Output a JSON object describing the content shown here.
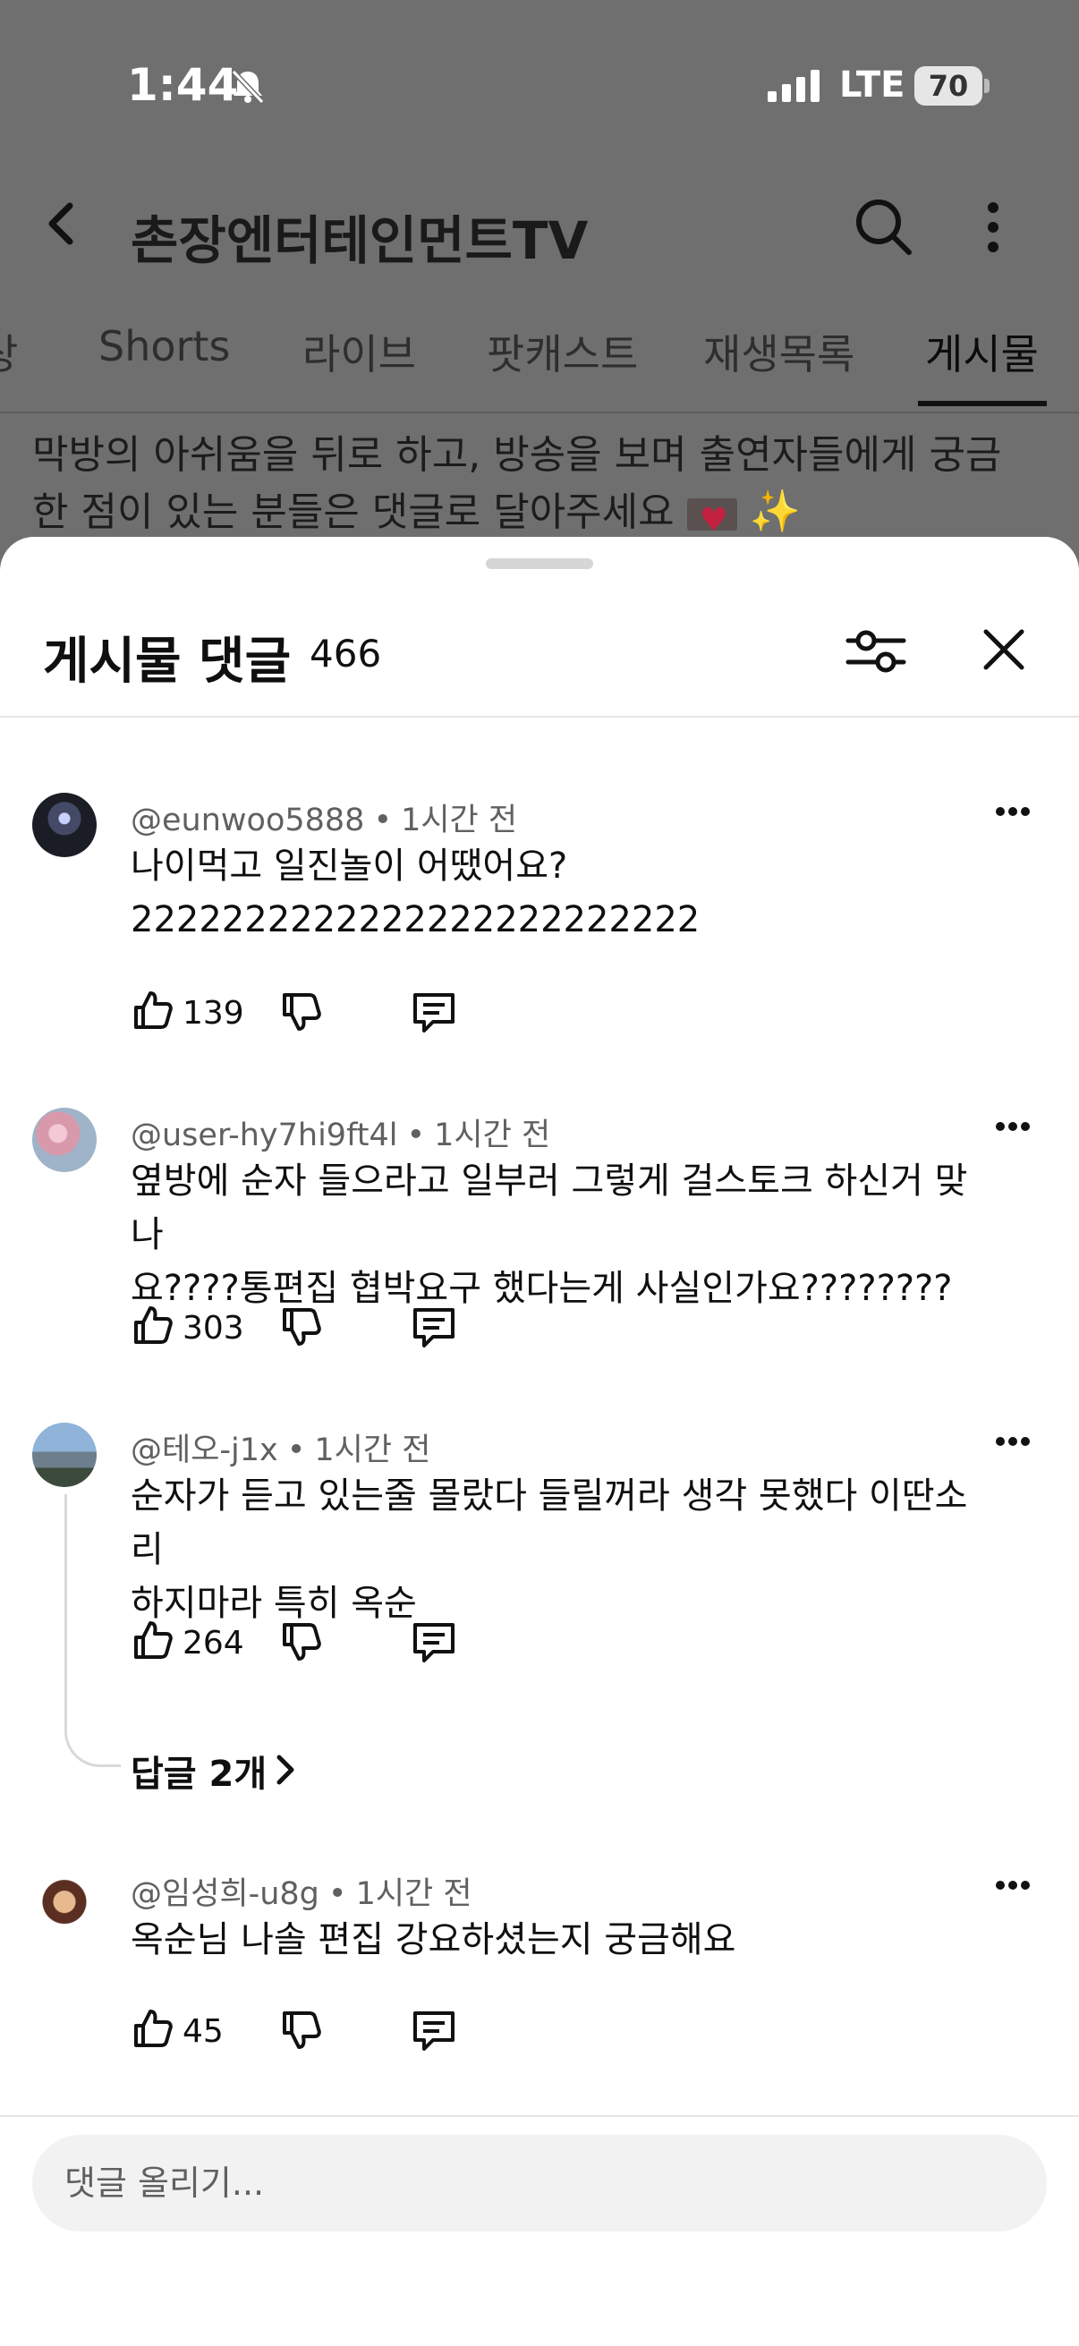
{
  "status_bar": {
    "time": "1:44",
    "network": "LTE",
    "battery": "70"
  },
  "header": {
    "channel_title": "촌장엔터테인먼트TV"
  },
  "tabs": [
    {
      "label": "상",
      "active": false
    },
    {
      "label": "Shorts",
      "active": false
    },
    {
      "label": "라이브",
      "active": false
    },
    {
      "label": "팟캐스트",
      "active": false
    },
    {
      "label": "재생목록",
      "active": false
    },
    {
      "label": "게시물",
      "active": true
    }
  ],
  "post_preview": {
    "line1": "막방의 아쉬움을 뒤로 하고, 방송을 보며 출연자들에게 궁금",
    "line2": "한 점이 있는 분들은 댓글로 달아주세요"
  },
  "sheet": {
    "title": "게시물 댓글",
    "count": "466"
  },
  "comments": [
    {
      "author": "@eunwoo5888",
      "time": "1시간 전",
      "text_line1": "나이먹고 일진놀이 어땠어요?",
      "text_line2": "2222222222222222222222222",
      "likes": "139",
      "avatar_color": "#2a2a33"
    },
    {
      "author": "@user-hy7hi9ft4l",
      "time": "1시간 전",
      "text_line1": "옆방에 순자 들으라고 일부러 그렇게 걸스토크 하신거 맞나",
      "text_line2": "요????통편집 협박요구 했다는게 사실인가요????????",
      "likes": "303",
      "avatar_color": "#c98a9a"
    },
    {
      "author": "@테오-j1x",
      "time": "1시간 전",
      "text_line1": "순자가 듣고 있는줄 몰랐다 들릴꺼라 생각 못했다 이딴소리",
      "text_line2": "하지마라 특히 옥순",
      "likes": "264",
      "avatar_color": "#7a8fa8"
    },
    {
      "author": "@임성희-u8g",
      "time": "1시간 전",
      "text_line1": "옥순님 나솔 편집 강요하셨는지 궁금해요",
      "text_line2": "",
      "likes": "45",
      "avatar_color": "#6b3a2a"
    }
  ],
  "replies_link": "답글 2개",
  "comment_input": {
    "placeholder": "댓글 올리기..."
  }
}
